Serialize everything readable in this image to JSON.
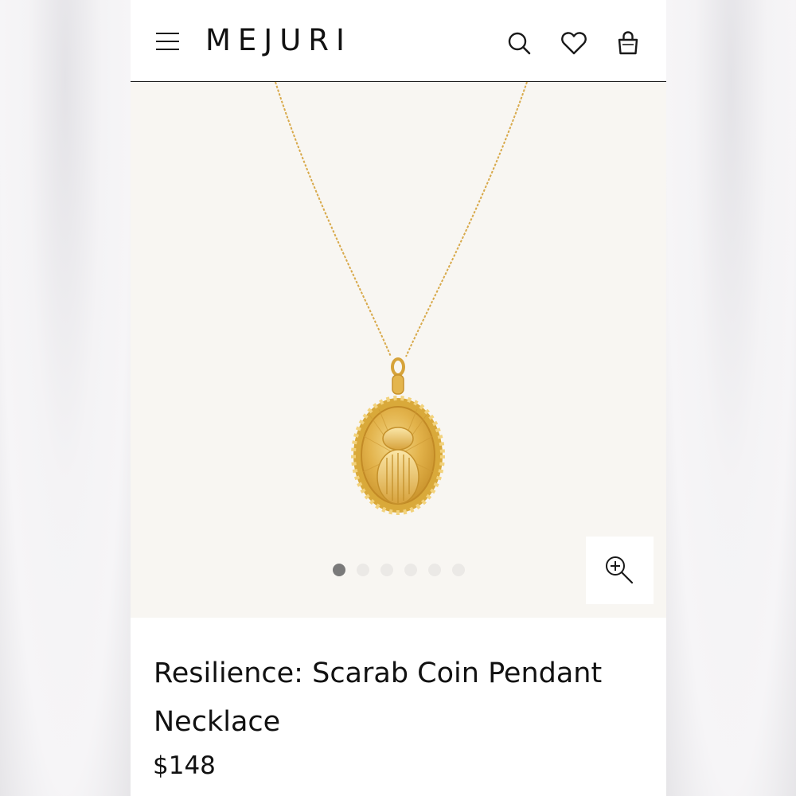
{
  "header": {
    "brand": "MEJURI",
    "icons": [
      "menu-icon",
      "search-icon",
      "heart-icon",
      "shopping-bag-icon"
    ]
  },
  "gallery": {
    "image_count": 6,
    "active_index": 0,
    "zoom_icon": "zoom-in-icon"
  },
  "product": {
    "title": "Resilience: Scarab Coin Pendant Necklace",
    "price": "$148"
  },
  "colors": {
    "background": "#f8f6f2",
    "gold": "#d9a93a",
    "text": "#111111",
    "dot_active": "#7a7a7a",
    "dot_inactive": "#ebe9e6"
  }
}
